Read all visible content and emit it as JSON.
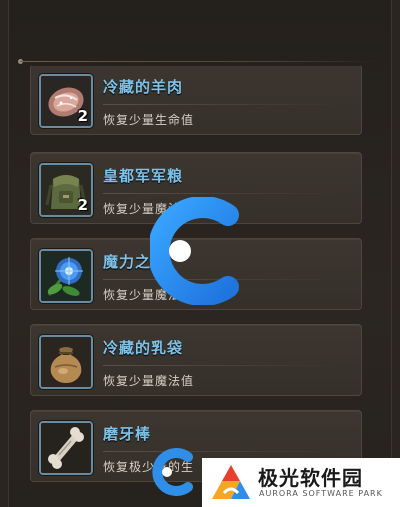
{
  "items": [
    {
      "name": "冷藏的羊肉",
      "desc": "恢复少量生命值",
      "qty": "2",
      "icon": "meat-icon"
    },
    {
      "name": "皇都军军粮",
      "desc": "恢复少量魔法值",
      "qty": "2",
      "icon": "backpack-icon"
    },
    {
      "name": "魔力之",
      "desc": "恢复少量魔法值",
      "qty": "",
      "icon": "blue-flower-icon"
    },
    {
      "name": "冷藏的乳袋",
      "desc": "恢复少量魔法值",
      "qty": "",
      "icon": "sack-icon"
    },
    {
      "name": "磨牙棒",
      "desc": "恢复极少量的生",
      "qty": "",
      "icon": "bone-icon"
    }
  ],
  "watermark": {
    "title": "极光软件园",
    "subtitle": "AURORA SOFTWARE PARK"
  },
  "colors": {
    "name": "#7fc2e9",
    "desc": "#d7d0c6",
    "icon_border": "#6a8ca3",
    "watermark_blue": "#2f8fe8"
  }
}
